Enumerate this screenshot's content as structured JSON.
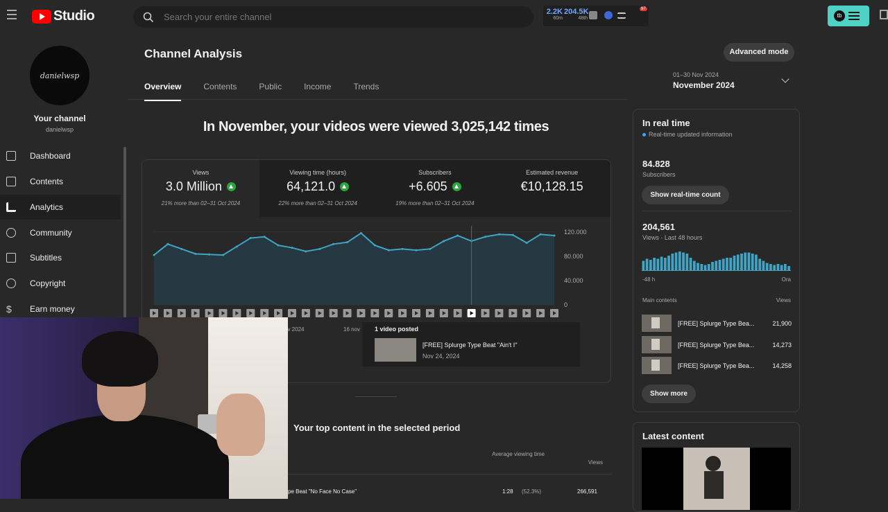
{
  "topbar": {
    "app_name": "Studio",
    "search_placeholder": "Search your entire channel",
    "stat1_value": "2.2K",
    "stat1_sub": "60m",
    "stat2_value": "204.5K",
    "stat2_sub": "48th",
    "notif_badge": "97"
  },
  "sidebar": {
    "avatar_text": "danielwsp",
    "channel_title": "Your channel",
    "channel_handle": "danielwsp",
    "items": [
      {
        "label": "Dashboard",
        "icon": "dashboard-icon"
      },
      {
        "label": "Contents",
        "icon": "contents-icon"
      },
      {
        "label": "Analytics",
        "icon": "analytics-icon"
      },
      {
        "label": "Community",
        "icon": "community-icon"
      },
      {
        "label": "Subtitles",
        "icon": "subtitles-icon"
      },
      {
        "label": "Copyright",
        "icon": "copyright-icon"
      },
      {
        "label": "Earn money",
        "icon": "earn-money-icon"
      }
    ]
  },
  "header": {
    "title": "Channel Analysis",
    "advanced_label": "Advanced mode",
    "tabs": [
      "Overview",
      "Contents",
      "Public",
      "Income",
      "Trends"
    ],
    "date_range": "01–30 Nov 2024",
    "date_label": "November 2024"
  },
  "overview": {
    "headline": "In November, your videos were viewed 3,025,142 times",
    "metrics": [
      {
        "label": "Views",
        "value": "3.0 Million",
        "compare": "21% more than 02–31 Oct 2024",
        "up": true
      },
      {
        "label": "Viewing time (hours)",
        "value": "64,121.0",
        "compare": "22% more than 02–31 Oct 2024",
        "up": true
      },
      {
        "label": "Subscribers",
        "value": "+6.605",
        "compare": "19% more than 02–31 Oct 2024",
        "up": true
      },
      {
        "label": "Estimated revenue",
        "value": "€10,128.15",
        "compare": "",
        "up": false
      }
    ],
    "x_labels": [
      "ov 2024",
      "16 nov"
    ],
    "tooltip": {
      "title": "1 video posted",
      "video": "[FREE] Splurge Type Beat \"Ain't I\"",
      "date": "Nov 24, 2024"
    }
  },
  "chart_data": {
    "type": "area",
    "x": [
      1,
      2,
      3,
      4,
      5,
      6,
      7,
      8,
      9,
      10,
      11,
      12,
      13,
      14,
      15,
      16,
      17,
      18,
      19,
      20,
      21,
      22,
      23,
      24,
      25,
      26,
      27,
      28,
      29,
      30
    ],
    "values": [
      82000,
      100000,
      92000,
      84000,
      83000,
      82000,
      96000,
      110000,
      112000,
      98000,
      94000,
      88000,
      92000,
      100000,
      103000,
      118000,
      98000,
      90000,
      92000,
      90000,
      92000,
      105000,
      114000,
      105000,
      112000,
      116000,
      115000,
      102000,
      116000,
      114000
    ],
    "ylim": [
      0,
      130000
    ],
    "y_ticks": [
      "120.000",
      "80.000",
      "40.000",
      "0"
    ],
    "title": "",
    "xlabel": "",
    "ylabel": ""
  },
  "top_content": {
    "title": "Your top content in the selected period",
    "col_avg": "Average viewing time",
    "col_views": "Views",
    "row_title": "pe Beat \"No Face No Case\"",
    "row_avg": "1:28",
    "row_pct": "(52.3%)",
    "row_views": "266,591"
  },
  "realtime": {
    "title": "In real time",
    "subtitle": "Real-time updated information",
    "subs_value": "84.828",
    "subs_label": "Subscribers",
    "show_count_label": "Show real-time count",
    "views_value": "204,561",
    "views_label": "Views · Last 48 hours",
    "axis_left": "-48 h",
    "axis_right": "Ora",
    "bars": [
      0.45,
      0.55,
      0.5,
      0.6,
      0.55,
      0.65,
      0.6,
      0.7,
      0.8,
      0.85,
      0.9,
      0.85,
      0.8,
      0.6,
      0.45,
      0.35,
      0.3,
      0.25,
      0.3,
      0.4,
      0.45,
      0.5,
      0.55,
      0.6,
      0.6,
      0.7,
      0.75,
      0.8,
      0.85,
      0.85,
      0.8,
      0.75,
      0.55,
      0.45,
      0.35,
      0.3,
      0.25,
      0.3,
      0.25,
      0.3,
      0.2
    ],
    "main_contents_label": "Main contents",
    "views_col_label": "Views",
    "contents": [
      {
        "title": "[FREE] Splurge Type Bea...",
        "views": "21,900"
      },
      {
        "title": "[FREE] Splurge Type Bea...",
        "views": "14,273"
      },
      {
        "title": "[FREE] Splurge Type Bea...",
        "views": "14,258"
      }
    ],
    "show_more_label": "Show more"
  },
  "latest": {
    "title": "Latest content"
  }
}
